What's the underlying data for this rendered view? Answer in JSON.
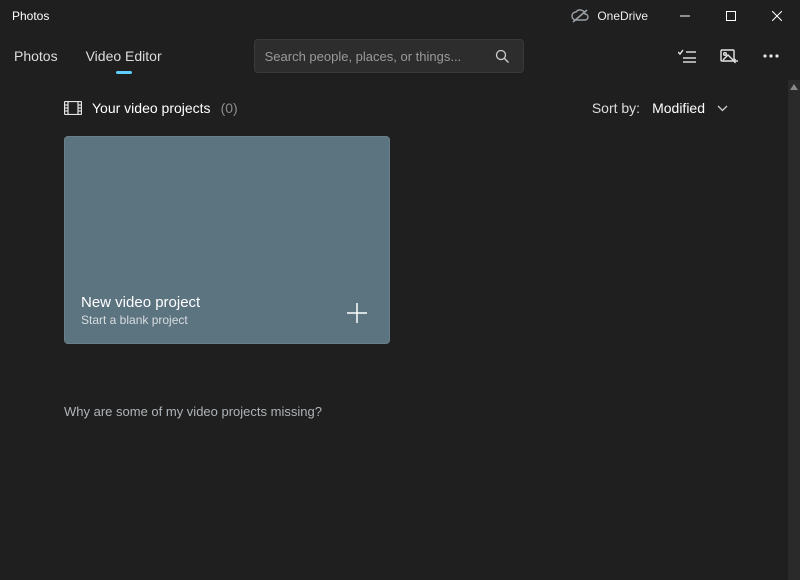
{
  "titlebar": {
    "app_title": "Photos",
    "onedrive_label": "OneDrive"
  },
  "tabs": {
    "photos": "Photos",
    "video_editor": "Video Editor"
  },
  "search": {
    "placeholder": "Search people, places, or things..."
  },
  "projects": {
    "heading": "Your video projects",
    "count": "(0)",
    "sort_label": "Sort by:",
    "sort_value": "Modified"
  },
  "new_card": {
    "title": "New video project",
    "subtitle": "Start a blank project"
  },
  "help_link": "Why are some of my video projects missing?"
}
